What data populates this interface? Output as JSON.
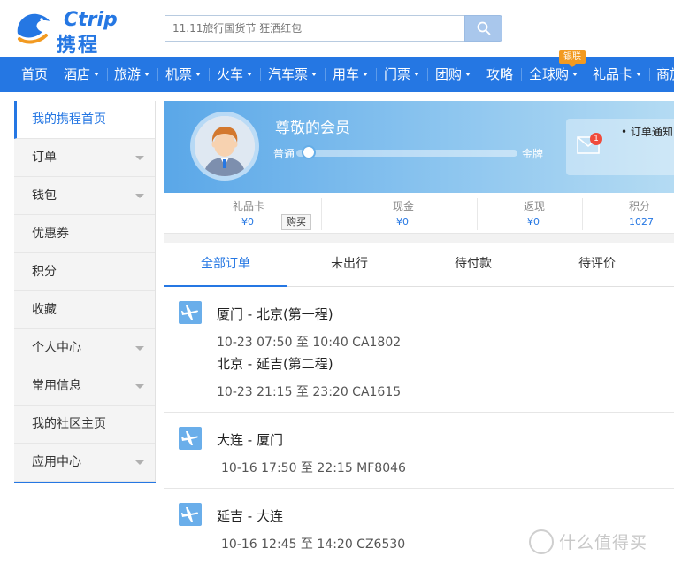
{
  "logo": {
    "en": "Ctrip",
    "cn": "携程"
  },
  "search": {
    "placeholder": "11.11旅行国货节 狂洒红包"
  },
  "nav": {
    "items": [
      "首页",
      "酒店",
      "旅游",
      "机票",
      "火车",
      "汽车票",
      "用车",
      "门票",
      "团购",
      "攻略",
      "全球购",
      "礼品卡",
      "商旅"
    ],
    "badge": "银联"
  },
  "sidebar": {
    "items": [
      "我的携程首页",
      "订单",
      "钱包",
      "优惠券",
      "积分",
      "收藏",
      "个人中心",
      "常用信息",
      "我的社区主页",
      "应用中心"
    ]
  },
  "member": {
    "title": "尊敬的会员",
    "level_current": "普通",
    "level_next": "金牌",
    "progress": 0.04,
    "notice_count": "1",
    "notice_text": "订单通知"
  },
  "stats": {
    "gift_card_label": "礼品卡",
    "gift_card_value": "¥0",
    "buy_label": "购买",
    "cash_label": "现金",
    "cash_value": "¥0",
    "rebate_label": "返现",
    "rebate_value": "¥0",
    "points_label": "积分",
    "points_value": "1027"
  },
  "tabs": [
    "全部订单",
    "未出行",
    "待付款",
    "待评价"
  ],
  "orders": [
    {
      "route1": "厦门 - 北京(第一程)",
      "time1": "10-23 07:50 至  10:40 CA1802",
      "route2": "北京 - 延吉(第二程)",
      "time2": "10-23 21:15 至  23:20 CA1615"
    },
    {
      "route1": "大连 - 厦门",
      "time1": "10-16 17:50 至  22:15 MF8046"
    },
    {
      "route1": "延吉 - 大连",
      "time1": "10-16 12:45 至  14:20 CZ6530"
    }
  ],
  "watermark": "什么值得买",
  "colors": {
    "brand": "#2577e3",
    "badge": "#f29a21"
  }
}
